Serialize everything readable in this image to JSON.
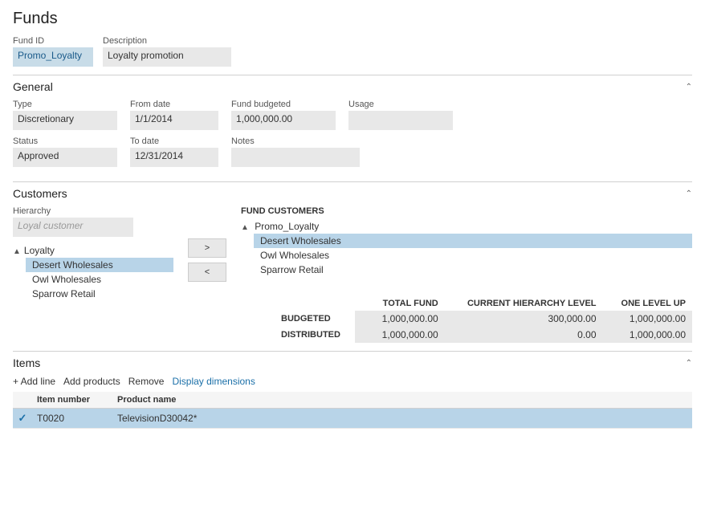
{
  "page": {
    "title": "Funds"
  },
  "header": {
    "fund_id_label": "Fund ID",
    "fund_id_value": "Promo_Loyalty",
    "description_label": "Description",
    "description_value": "Loyalty promotion"
  },
  "general": {
    "title": "General",
    "type_label": "Type",
    "type_value": "Discretionary",
    "from_date_label": "From date",
    "from_date_value": "1/1/2014",
    "fund_budgeted_label": "Fund budgeted",
    "fund_budgeted_value": "1,000,000.00",
    "usage_label": "Usage",
    "usage_value": "",
    "status_label": "Status",
    "status_value": "Approved",
    "to_date_label": "To date",
    "to_date_value": "12/31/2014",
    "notes_label": "Notes",
    "notes_value": ""
  },
  "customers": {
    "title": "Customers",
    "hierarchy_label": "Hierarchy",
    "hierarchy_placeholder": "Loyal customer",
    "arrow_right": ">",
    "arrow_left": "<",
    "fund_customers_label": "FUND CUSTOMERS",
    "tree_left": [
      {
        "label": "Loyalty",
        "type": "parent",
        "icon": "▲"
      },
      {
        "label": "Desert Wholesales",
        "type": "child",
        "selected": true
      },
      {
        "label": "Owl Wholesales",
        "type": "child",
        "selected": false
      },
      {
        "label": "Sparrow Retail",
        "type": "child",
        "selected": false
      }
    ],
    "tree_right_root": "Promo_Loyalty",
    "tree_right": [
      {
        "label": "Desert Wholesales",
        "type": "child",
        "selected": true
      },
      {
        "label": "Owl Wholesales",
        "type": "child",
        "selected": false
      },
      {
        "label": "Sparrow Retail",
        "type": "child",
        "selected": false
      }
    ],
    "summary": {
      "col1": "TOTAL FUND",
      "col2": "CURRENT HIERARCHY LEVEL",
      "col3": "ONE LEVEL UP",
      "row1_label": "BUDGETED",
      "row1_col1": "1,000,000.00",
      "row1_col2": "300,000.00",
      "row1_col3": "1,000,000.00",
      "row2_label": "DISTRIBUTED",
      "row2_col1": "1,000,000.00",
      "row2_col2": "0.00",
      "row2_col3": "1,000,000.00"
    }
  },
  "items": {
    "title": "Items",
    "toolbar": {
      "add_line": "+ Add line",
      "add_products": "Add products",
      "remove": "Remove",
      "display_dimensions": "Display dimensions"
    },
    "columns": {
      "check": "",
      "item_number": "Item number",
      "product_name": "Product name"
    },
    "rows": [
      {
        "check": "✓",
        "item_number": "T0020",
        "product_name": "TelevisionD30042*",
        "selected": true
      }
    ]
  }
}
